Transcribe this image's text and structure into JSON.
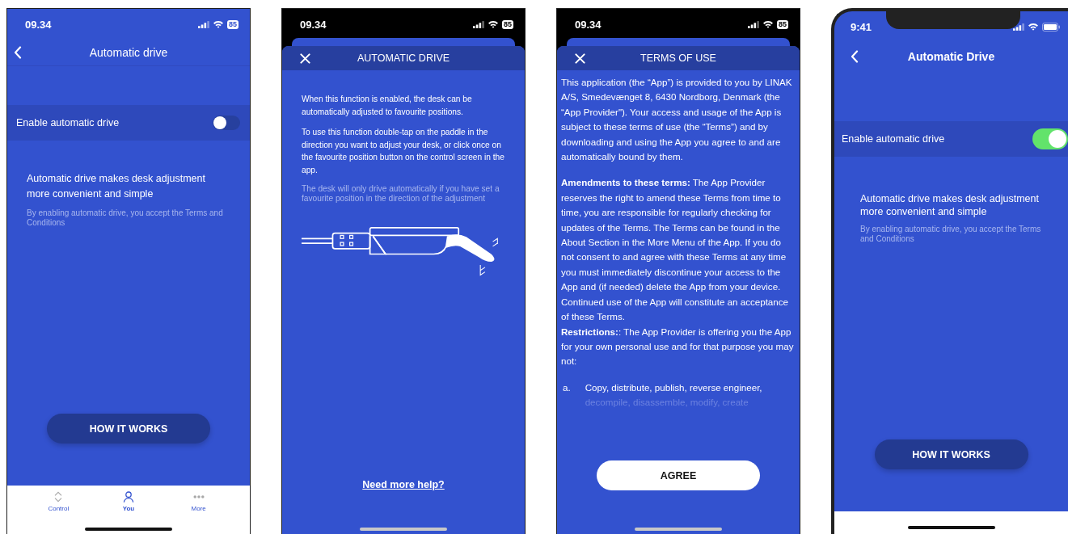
{
  "screens": [
    {
      "kind": "settings",
      "notch": false,
      "status": {
        "time": "09.34",
        "battery": "85"
      },
      "title": "Automatic drive",
      "toggle": {
        "label": "Enable automatic drive",
        "on": false
      },
      "description": "Automatic drive makes desk adjustment more convenient and simple",
      "note": "By enabling automatic drive, you accept the Terms and Conditions",
      "button": "HOW IT WORKS",
      "tab_bar": [
        {
          "label": "Control",
          "selected": false
        },
        {
          "label": "You",
          "selected": true
        },
        {
          "label": "More",
          "selected": false
        }
      ]
    },
    {
      "kind": "info",
      "notch": false,
      "status": {
        "time": "09.34",
        "battery": "85"
      },
      "title": "AUTOMATIC DRIVE",
      "paragraphs": [
        "When this function is enabled, the desk can be automatically adjusted to favourite positions.",
        "To use this function double-tap on the paddle in the direction you want to adjust your desk, or click once on the favourite position button on the control screen in the app."
      ],
      "note": "The desk will only drive automatically if you have set a favourite position in the direction of the adjustment",
      "link": "Need more help?"
    },
    {
      "kind": "terms",
      "notch": false,
      "status": {
        "time": "09.34",
        "battery": "85"
      },
      "title": "TERMS OF USE",
      "paragraphs": [
        "This application (the “App”) is provided to you by LINAK A/S, Smedevænget 8, 6430 Nordborg, Denmark (the “App Provider\"). Your access and usage of the App is subject to these terms of use (the “Terms”) and by downloading and using the App you agree to and are automatically bound by them.",
        "**Amendments to these terms:** The App Provider reserves the right to amend these Terms from time to time, you are responsible for regularly checking for updates of the Terms. The Terms can be found in the About Section in the More Menu of the App. If you do not consent to and agree with these Terms at any time you must immediately discontinue your access to the App and (if needed) delete the App from your device. Continued use of the App will constitute an acceptance of these Terms.\n**Restrictions:**: The App Provider is offering you the App for your own personal use and for that purpose you may not:"
      ],
      "list_items": [
        {
          "marker": "a.",
          "lines": [
            {
              "text": "Copy, distribute, publish, reverse engineer,",
              "faded": false
            },
            {
              "text": "decompile, disassemble, modify, create",
              "faded": true
            }
          ]
        }
      ],
      "button": "AGREE"
    },
    {
      "kind": "settings",
      "notch": true,
      "status": {
        "time": "9:41"
      },
      "title": "Automatic Drive",
      "toggle": {
        "label": "Enable automatic drive",
        "on": true
      },
      "description": "Automatic drive makes desk adjustment more convenient and simple",
      "note": "By enabling automatic drive, you accept the Terms and Conditions",
      "button": "HOW IT WORKS"
    }
  ]
}
